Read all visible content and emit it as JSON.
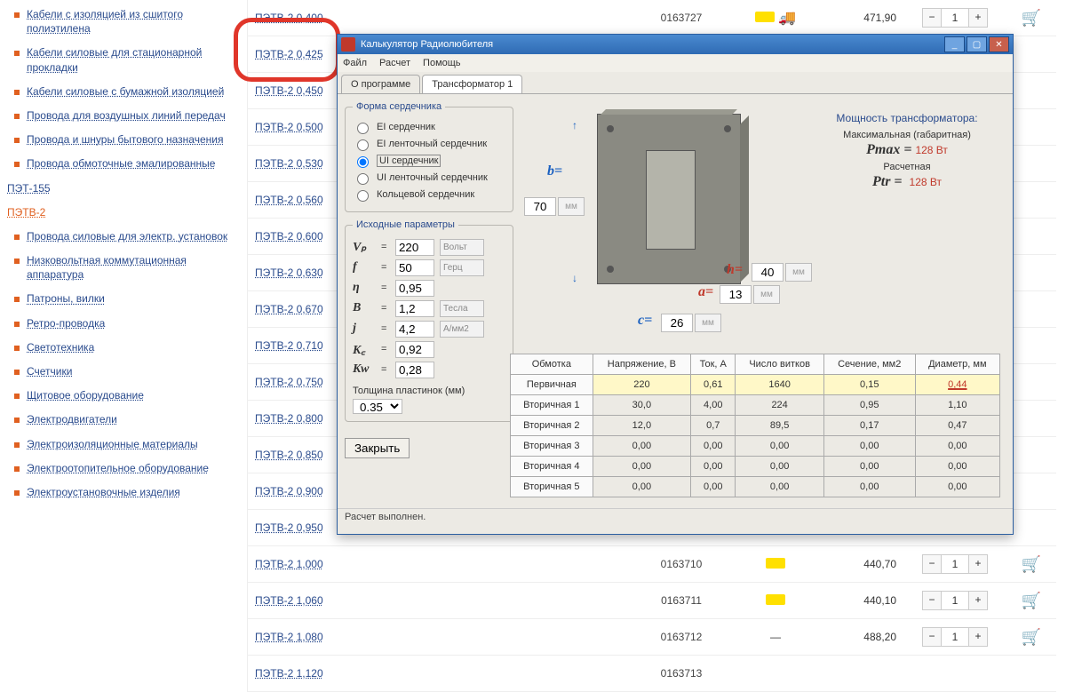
{
  "sidebar": {
    "items": [
      {
        "label": "Кабели с изоляцией из сшитого полиэтилена"
      },
      {
        "label": "Кабели силовые для стационарной прокладки"
      },
      {
        "label": "Кабели силовые с бумажной изоляцией"
      },
      {
        "label": "Провода для воздушных линий передач"
      },
      {
        "label": "Провода и шнуры бытового назначения"
      },
      {
        "label": "Провода обмоточные эмалированные"
      },
      {
        "label": "Провода силовые для электр. установок"
      }
    ],
    "nested": [
      {
        "label": "ПЭТ-155"
      },
      {
        "label": "ПЭТВ-2",
        "active": true
      }
    ],
    "cats": [
      {
        "label": "Низковольтная коммутационная аппаратура"
      },
      {
        "label": "Патроны, вилки"
      },
      {
        "label": "Ретро-проводка"
      },
      {
        "label": "Светотехника"
      },
      {
        "label": "Счетчики"
      },
      {
        "label": "Щитовое оборудование"
      },
      {
        "label": "Электродвигатели"
      },
      {
        "label": "Электроизоляционные материалы"
      },
      {
        "label": "Электроотопительное оборудование"
      },
      {
        "label": "Электроустановочные изделия"
      }
    ]
  },
  "products": [
    {
      "name": "ПЭТВ-2 0,400",
      "code": "0163727",
      "price": "471,90",
      "qty": "1",
      "truck": true,
      "bar": true
    },
    {
      "name": "ПЭТВ-2 0,425"
    },
    {
      "name": "ПЭТВ-2 0,450"
    },
    {
      "name": "ПЭТВ-2 0,500"
    },
    {
      "name": "ПЭТВ-2 0,530"
    },
    {
      "name": "ПЭТВ-2 0,560"
    },
    {
      "name": "ПЭТВ-2 0,600"
    },
    {
      "name": "ПЭТВ-2 0,630"
    },
    {
      "name": "ПЭТВ-2 0,670"
    },
    {
      "name": "ПЭТВ-2 0,710"
    },
    {
      "name": "ПЭТВ-2 0,750"
    },
    {
      "name": "ПЭТВ-2 0,800"
    },
    {
      "name": "ПЭТВ-2 0,850"
    },
    {
      "name": "ПЭТВ-2 0,900"
    },
    {
      "name": "ПЭТВ-2 0,950"
    },
    {
      "name": "ПЭТВ-2 1,000",
      "code": "0163710",
      "price": "440,70",
      "qty": "1",
      "bar": true
    },
    {
      "name": "ПЭТВ-2 1,060",
      "code": "0163711",
      "price": "440,10",
      "qty": "1",
      "bar": true
    },
    {
      "name": "ПЭТВ-2 1,080",
      "code": "0163712",
      "price": "488,20",
      "qty": "1",
      "dash": true
    },
    {
      "name": "ПЭТВ-2 1,120",
      "code": "0163713"
    }
  ],
  "dialog": {
    "title": "Калькулятор Радиолюбителя",
    "menu": [
      "Файл",
      "Расчет",
      "Помощь"
    ],
    "tabs": [
      "О программе",
      "Трансформатор 1"
    ],
    "core_legend": "Форма сердечника",
    "core_opts": [
      "EI сердечник",
      "EI ленточный сердечник",
      "UI сердечник",
      "UI ленточный сердечник",
      "Кольцевой сердечник"
    ],
    "core_selected": 2,
    "param_legend": "Исходные параметры",
    "params": [
      {
        "sym": "Vₚ",
        "val": "220",
        "unit": "Вольт"
      },
      {
        "sym": "f",
        "val": "50",
        "unit": "Герц"
      },
      {
        "sym": "η",
        "val": "0,95"
      },
      {
        "sym": "B",
        "val": "1,2",
        "unit": "Тесла"
      },
      {
        "sym": "j",
        "val": "4,2",
        "unit": "А/мм2"
      },
      {
        "sym": "K꜀",
        "val": "0,92"
      },
      {
        "sym": "Kᴡ",
        "val": "0,28"
      }
    ],
    "thickness_label": "Толщина пластинок (мм)",
    "thickness_val": "0.35",
    "close_btn": "Закрыть",
    "dims": {
      "b_label": "b=",
      "b": "70",
      "b_unit": "мм",
      "h_label": "h=",
      "h": "40",
      "h_unit": "мм",
      "a_label": "a=",
      "a": "13",
      "a_unit": "мм",
      "c_label": "c=",
      "c": "26",
      "c_unit": "мм"
    },
    "power": {
      "header": "Мощность трансформатора:",
      "max_label": "Максимальная (габаритная)",
      "max_sym": "Pmax =",
      "max_val": "128 Вт",
      "calc_label": "Расчетная",
      "calc_sym": "Ptr =",
      "calc_val": "128 Вт"
    },
    "table": {
      "headers": [
        "Обмотка",
        "Напряжение, В",
        "Ток, А",
        "Число витков",
        "Сечение, мм2",
        "Диаметр, мм"
      ],
      "rows": [
        {
          "lbl": "Первичная",
          "v": "220",
          "i": "0,61",
          "n": "1640",
          "s": "0,15",
          "d": "0,44",
          "primary": true
        },
        {
          "lbl": "Вторичная 1",
          "v": "30,0",
          "i": "4,00",
          "n": "224",
          "s": "0,95",
          "d": "1,10"
        },
        {
          "lbl": "Вторичная 2",
          "v": "12,0",
          "i": "0,7",
          "n": "89,5",
          "s": "0,17",
          "d": "0,47"
        },
        {
          "lbl": "Вторичная 3",
          "v": "0,00",
          "i": "0,00",
          "n": "0,00",
          "s": "0,00",
          "d": "0,00"
        },
        {
          "lbl": "Вторичная 4",
          "v": "0,00",
          "i": "0,00",
          "n": "0,00",
          "s": "0,00",
          "d": "0,00"
        },
        {
          "lbl": "Вторичная 5",
          "v": "0,00",
          "i": "0,00",
          "n": "0,00",
          "s": "0,00",
          "d": "0,00"
        }
      ]
    },
    "status": "Расчет выполнен."
  }
}
